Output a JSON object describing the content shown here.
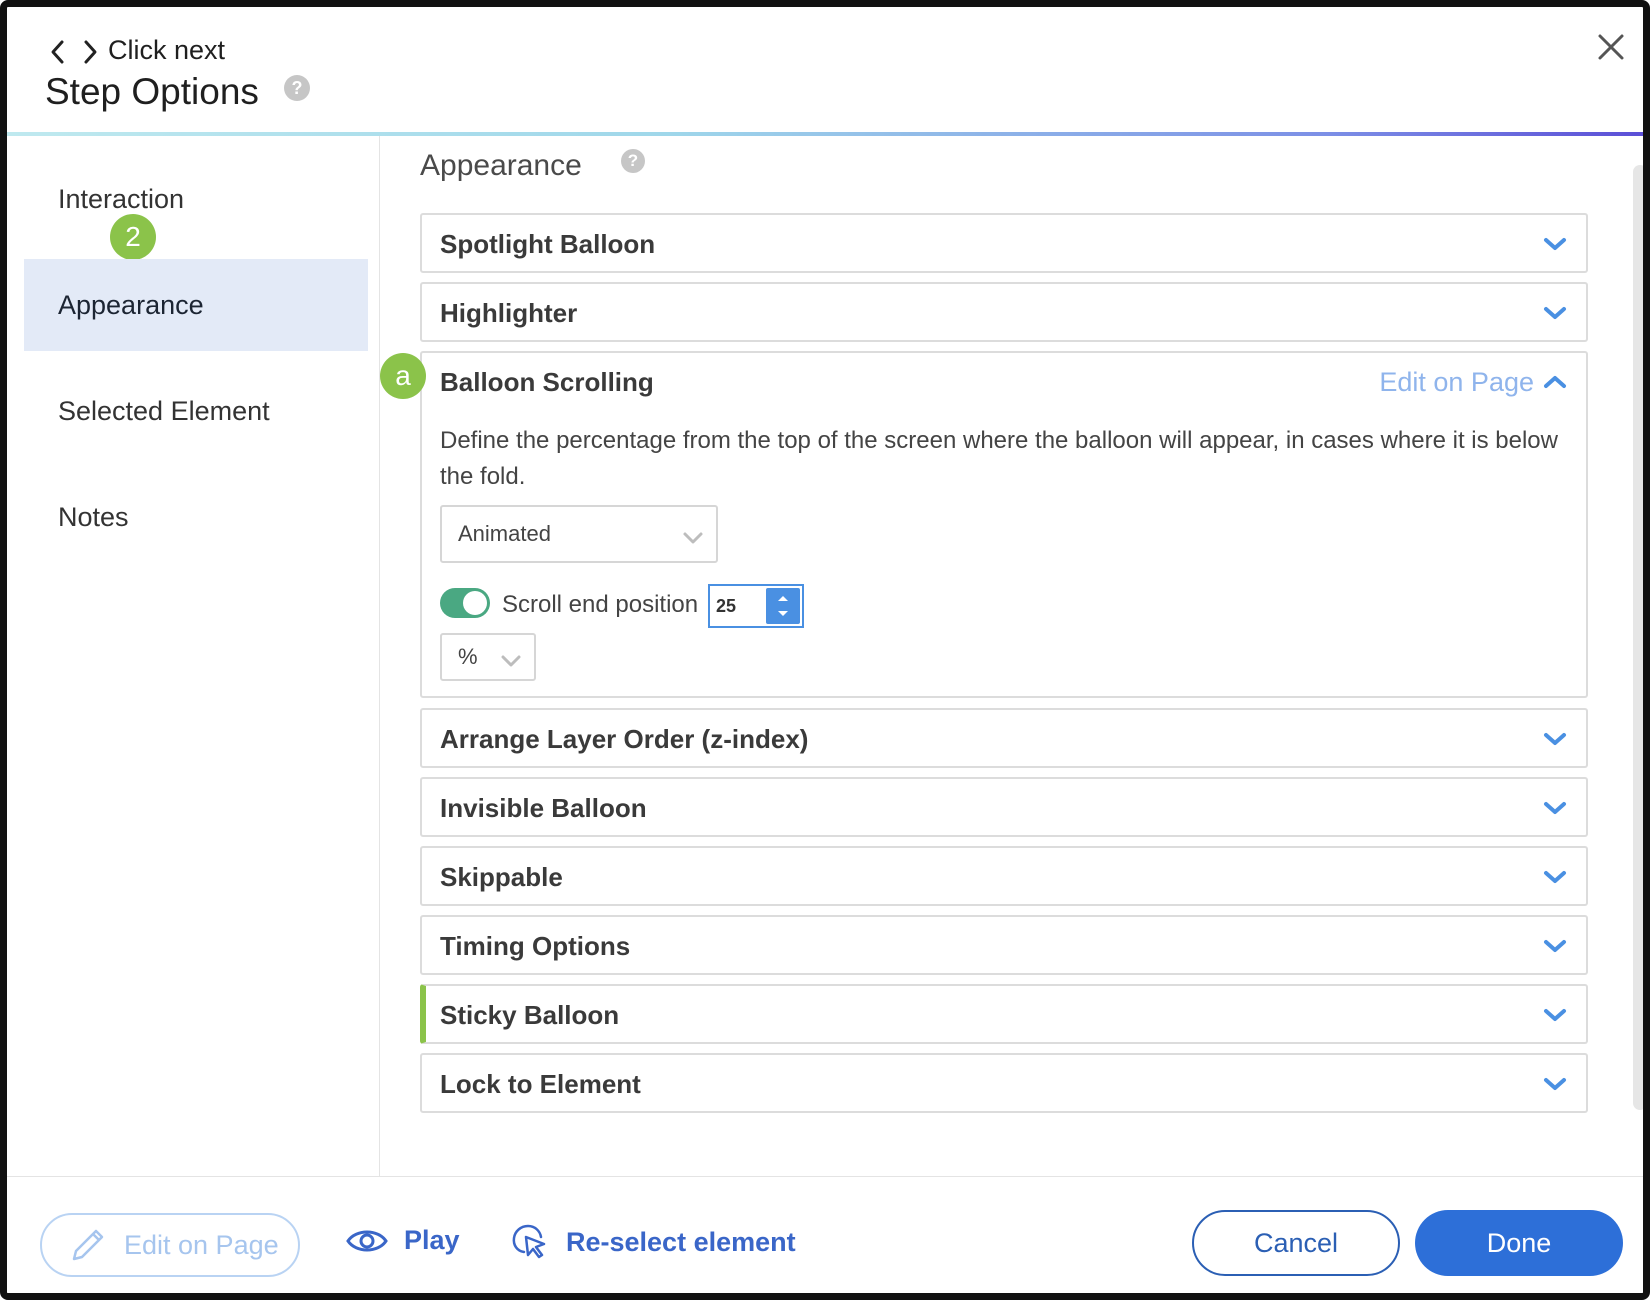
{
  "header": {
    "step_name": "Click next",
    "title": "Step Options",
    "help_glyph": "?"
  },
  "sidebar": {
    "items": [
      {
        "label": "Interaction",
        "active": false
      },
      {
        "label": "Appearance",
        "active": true
      },
      {
        "label": "Selected Element",
        "active": false
      },
      {
        "label": "Notes",
        "active": false
      }
    ],
    "badge": "2"
  },
  "main": {
    "section_title": "Appearance",
    "help_glyph": "?",
    "accordions": [
      {
        "title": "Spotlight Balloon",
        "expanded": false
      },
      {
        "title": "Highlighter",
        "expanded": false
      },
      {
        "title": "Balloon Scrolling",
        "expanded": true
      },
      {
        "title": "Arrange Layer Order (z-index)",
        "expanded": false
      },
      {
        "title": "Invisible Balloon",
        "expanded": false
      },
      {
        "title": "Skippable",
        "expanded": false
      },
      {
        "title": "Timing Options",
        "expanded": false
      },
      {
        "title": "Sticky Balloon",
        "expanded": false
      },
      {
        "title": "Lock to Element",
        "expanded": false
      }
    ],
    "balloon_scrolling": {
      "badge": "a",
      "edit_link": "Edit on Page",
      "description": "Define the percentage from the top of the screen where the balloon will appear, in cases where it is below the fold.",
      "mode_select": "Animated",
      "toggle_on": true,
      "scroll_label": "Scroll end position",
      "scroll_value": "25",
      "unit_select": "%"
    }
  },
  "footer": {
    "edit_on_page": "Edit on Page",
    "play": "Play",
    "reselect": "Re-select element",
    "cancel": "Cancel",
    "done": "Done"
  },
  "colors": {
    "accent": "#2d6fd8",
    "badge_green": "#8bc34a",
    "toggle_green": "#4aa882",
    "active_nav_bg": "#e3eaf7"
  }
}
